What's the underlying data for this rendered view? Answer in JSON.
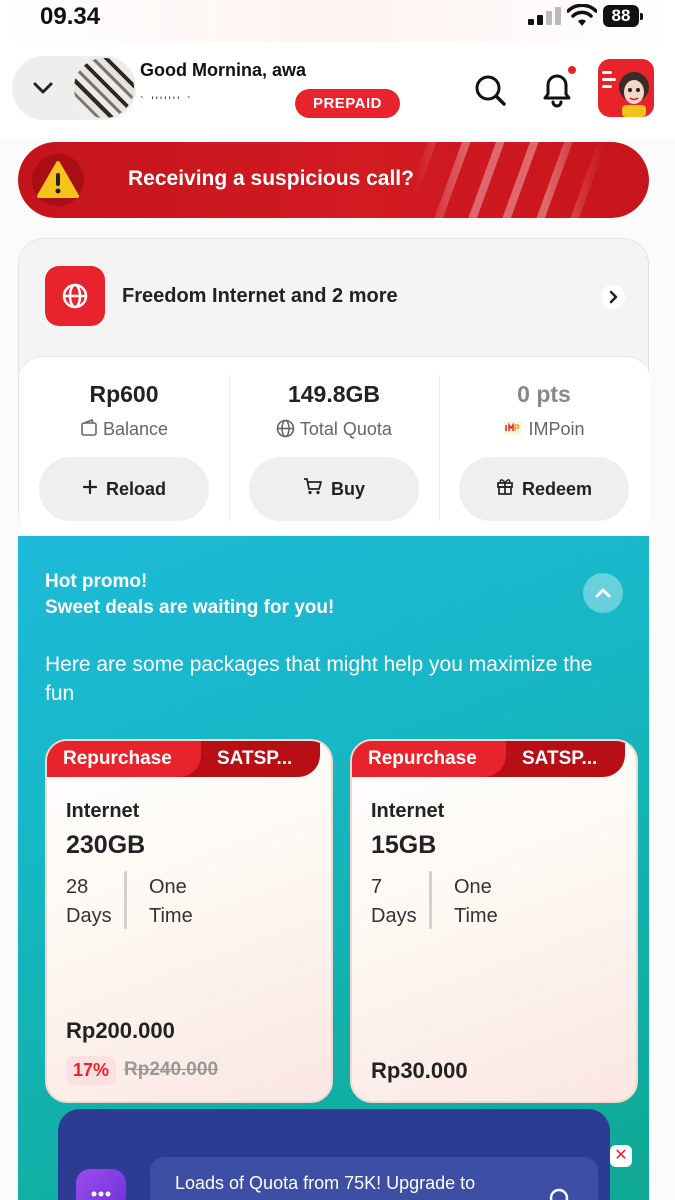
{
  "status_bar": {
    "time": "09.34",
    "battery": "88"
  },
  "header": {
    "greeting": "Good Mornina, awa",
    "phone_number": "`           '''''''      `",
    "plan_badge": "PREPAID",
    "icons": [
      "chevron-down-icon",
      "search-icon",
      "bell-icon",
      "menu-avatar-icon"
    ]
  },
  "alert_banner": {
    "text": "Receiving a suspicious call?"
  },
  "package_card": {
    "title": "Freedom Internet and 2 more",
    "stats": [
      {
        "value": "Rp600",
        "label": "Balance",
        "icon": "wallet-icon"
      },
      {
        "value": "149.8GB",
        "label": "Total Quota",
        "icon": "globe-icon"
      },
      {
        "value": "0 pts",
        "label": "IMPoin",
        "icon": "impoin-icon"
      }
    ],
    "actions": [
      {
        "label": "Reload",
        "icon": "plus-icon"
      },
      {
        "label": "Buy",
        "icon": "cart-icon"
      },
      {
        "label": "Redeem",
        "icon": "gift-icon"
      }
    ]
  },
  "promo": {
    "title_line1": "Hot promo!",
    "title_line2": "Sweet deals are waiting for you!",
    "description": "Here are some packages that might help you maximize the fun",
    "offers": [
      {
        "tag_primary": "Repurchase",
        "tag_secondary": "SATSP...",
        "type": "Internet",
        "size": "230GB",
        "duration_value": "28",
        "duration_unit": "Days",
        "frequency_line1": "One",
        "frequency_line2": "Time",
        "price": "Rp200.000",
        "discount": "17%",
        "original_price": "Rp240.000"
      },
      {
        "tag_primary": "Repurchase",
        "tag_secondary": "SATSP...",
        "type": "Internet",
        "size": "15GB",
        "duration_value": "7",
        "duration_unit": "Days",
        "frequency_line1": "One",
        "frequency_line2": "Time",
        "price": "Rp30.000"
      }
    ]
  },
  "upsell": {
    "text": "Loads of Quota from 75K! Upgrade to"
  },
  "colors": {
    "brand_red": "#e8232b",
    "promo_teal": "#17b7c6",
    "upsell_navy": "#2c3c93"
  }
}
